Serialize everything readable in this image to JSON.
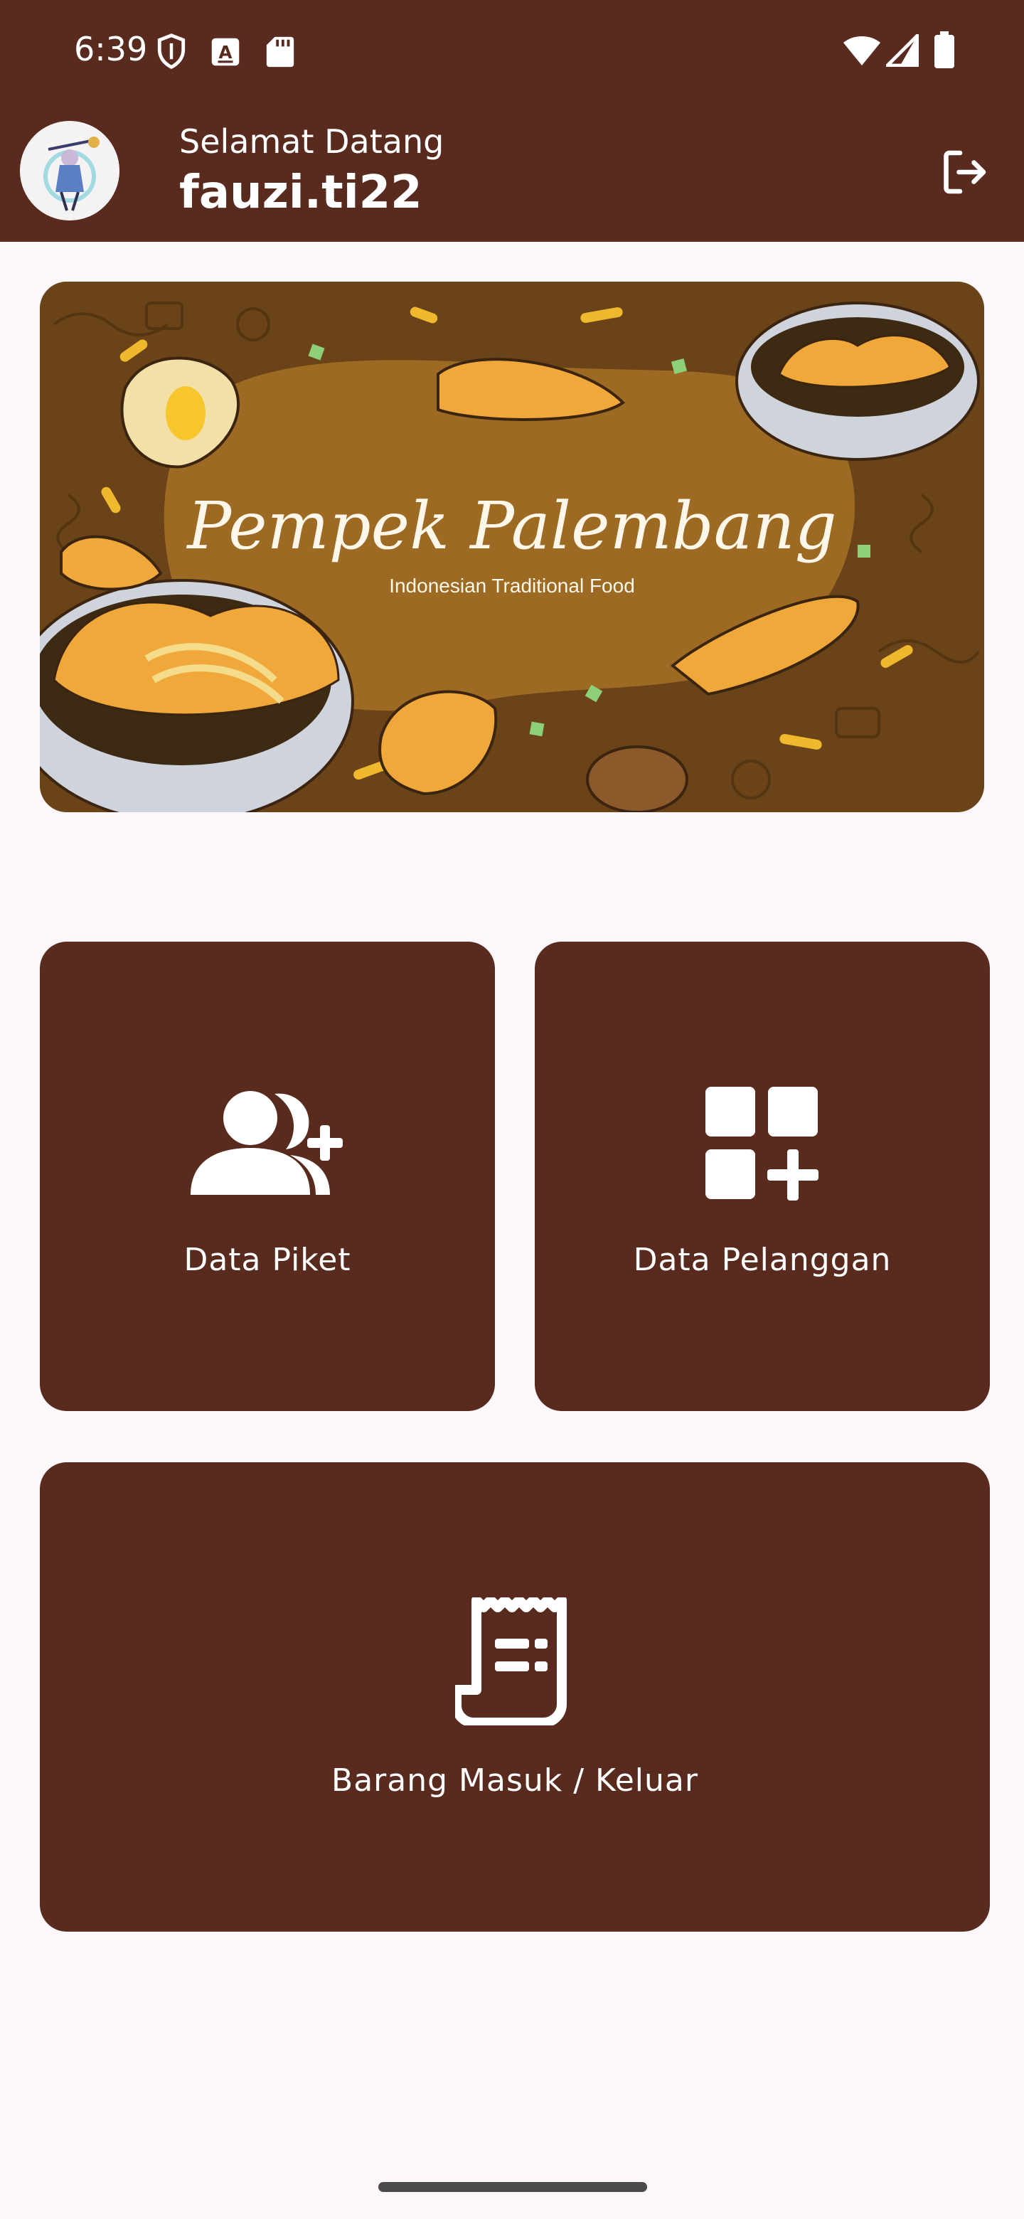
{
  "status_bar": {
    "time": "6:39",
    "icons": [
      "shield-icon",
      "text-a-icon",
      "sd-card-icon",
      "wifi-icon",
      "signal-icon",
      "battery-icon"
    ]
  },
  "header": {
    "greeting": "Selamat Datang",
    "username": "fauzi.ti22",
    "logout_icon": "logout-icon",
    "background_color": "#582b1e"
  },
  "banner": {
    "title": "Pempek Palembang",
    "subtitle": "Indonesian Traditional Food"
  },
  "menu": {
    "cards": [
      {
        "label": "Data Piket",
        "icon": "person-add-icon"
      },
      {
        "label": "Data Pelanggan",
        "icon": "grid-add-icon"
      },
      {
        "label": "Barang Masuk / Keluar",
        "icon": "receipt-icon"
      }
    ],
    "card_color": "#582b1e"
  },
  "colors": {
    "primary": "#582b1e",
    "background": "#fdf6fb"
  }
}
